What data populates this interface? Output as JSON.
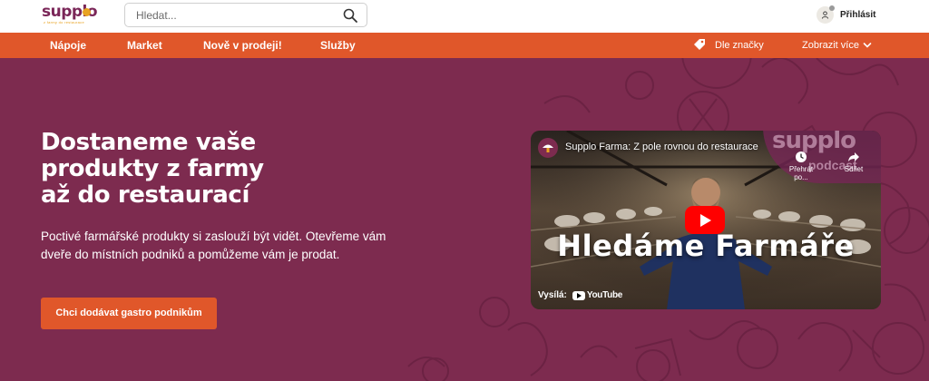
{
  "brand": {
    "name": "supplo",
    "tagline": "z farmy do restaurace",
    "accent": "#7a2658",
    "dot_color": "#e8a323"
  },
  "search": {
    "placeholder": "Hledat..."
  },
  "header": {
    "login_label": "Přihlásit"
  },
  "nav": {
    "items": [
      {
        "label": "Nápoje"
      },
      {
        "label": "Market"
      },
      {
        "label": "Nově v prodeji!"
      },
      {
        "label": "Služby"
      }
    ],
    "brands_label": "Dle značky",
    "more_label": "Zobrazit více",
    "color": "#e0572a"
  },
  "hero": {
    "title_lines": [
      "Dostaneme vaše",
      "produkty z farmy",
      "až do restaurací"
    ],
    "text": "Poctivé farmářské produkty si zaslouží být vidět. Otevřeme vám dveře do místních podniků a pomůžeme vám je prodat.",
    "cta_label": "Chci dodávat gastro podnikům",
    "background": "#7d2b4f"
  },
  "video": {
    "title": "Supplo Farma: Z pole rovnou do restaurace",
    "overlay_text": "Hledáme Farmáře",
    "podcast_word": "supplo",
    "podcast_sub": "podcast",
    "watch_later_label": "Přehrát po...",
    "share_label": "Sdílet",
    "via_label": "Vysílá:",
    "youtube_label": "YouTube",
    "icons": [
      "clock-icon",
      "share-icon",
      "play-icon",
      "youtube-icon"
    ]
  }
}
